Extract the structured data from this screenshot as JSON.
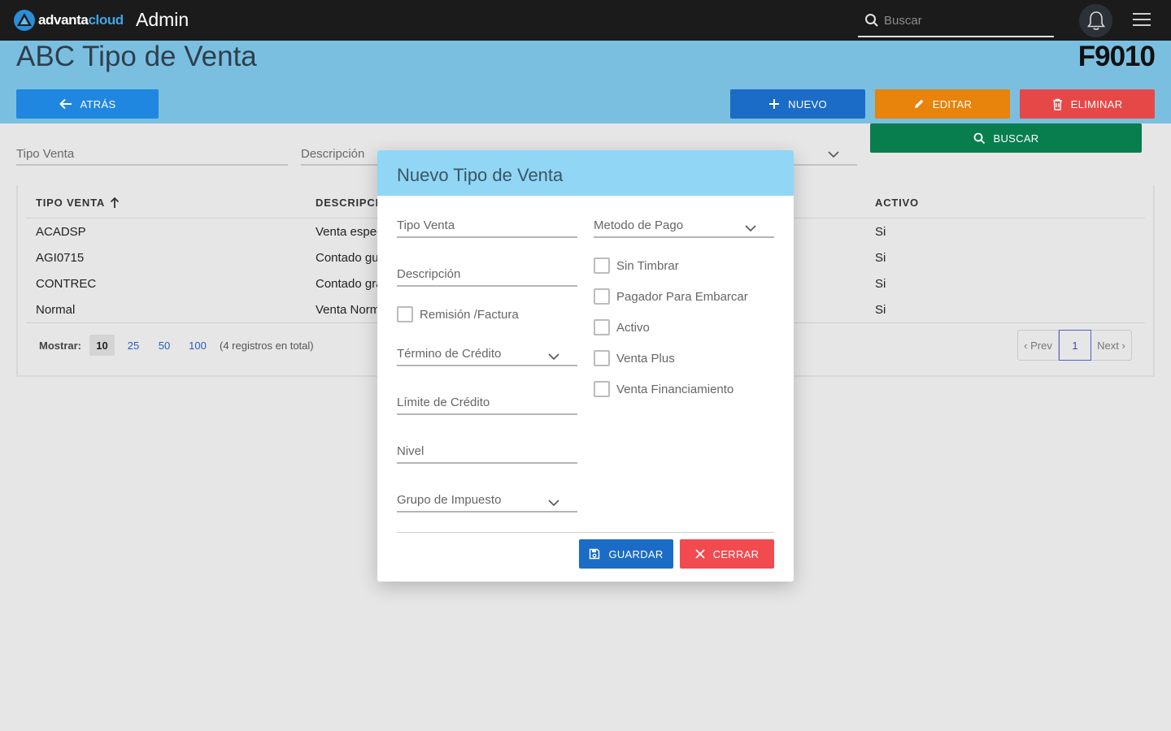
{
  "topbar": {
    "logo_text_1": "advanta",
    "logo_text_2": "cloud",
    "app_title": "Admin",
    "search_placeholder": "Buscar"
  },
  "header": {
    "title": "ABC Tipo de Venta",
    "code": "F9010",
    "back_label": "ATRÁS",
    "new_label": "NUEVO",
    "edit_label": "EDITAR",
    "delete_label": "ELIMINAR",
    "search_label": "BUSCAR"
  },
  "filters": {
    "tipo_venta": "Tipo Venta",
    "descripcion": "Descripción"
  },
  "table": {
    "columns": [
      "TIPO VENTA",
      "DESCRIPCI",
      "ACTIVO"
    ],
    "rows": [
      {
        "tipo": "ACADSP",
        "descripcion": "Venta espec",
        "activo": "Si"
      },
      {
        "tipo": "AGI0715",
        "descripcion": "Contado gu",
        "activo": "Si"
      },
      {
        "tipo": "CONTREC",
        "descripcion": "Contado gra",
        "activo": "Si"
      },
      {
        "tipo": "Normal",
        "descripcion": "Venta Norm",
        "activo": "Si"
      }
    ],
    "mostrar_label": "Mostrar:",
    "page_sizes": [
      "10",
      "25",
      "50",
      "100"
    ],
    "selected_page_size": "10",
    "total_text": "(4 registros en total)",
    "pager": {
      "prev": "‹ Prev",
      "current": "1",
      "next": "Next ›"
    }
  },
  "modal": {
    "title": "Nuevo Tipo de Venta",
    "fields_left": {
      "tipo_venta": "Tipo Venta",
      "descripcion": "Descripción",
      "remision": "Remisión /Factura",
      "termino_credito": "Término de Crédito",
      "limite_credito": "Límite de Crédito",
      "nivel": "Nivel",
      "grupo_impuesto": "Grupo de Impuesto"
    },
    "fields_right": {
      "metodo_pago": "Metodo de Pago",
      "sin_timbrar": "Sin Timbrar",
      "pagador": "Pagador Para Embarcar",
      "activo": "Activo",
      "venta_plus": "Venta Plus",
      "venta_financiamiento": "Venta Financiamiento"
    },
    "save_label": "GUARDAR",
    "close_label": "CERRAR"
  },
  "colors": {
    "topbar": "#1b1b1b",
    "band": "#7bbfe0",
    "modal_header": "#91d6f5",
    "primary": "#1a6cc7",
    "warning": "#e8830b",
    "danger": "#e64848",
    "success": "#087e4f"
  },
  "icons": [
    "logo-icon",
    "search-icon",
    "bell-icon",
    "menu-icon",
    "arrow-left-icon",
    "plus-icon",
    "pencil-icon",
    "trash-icon",
    "sort-up-icon",
    "chevron-down-icon",
    "save-icon",
    "close-icon"
  ]
}
